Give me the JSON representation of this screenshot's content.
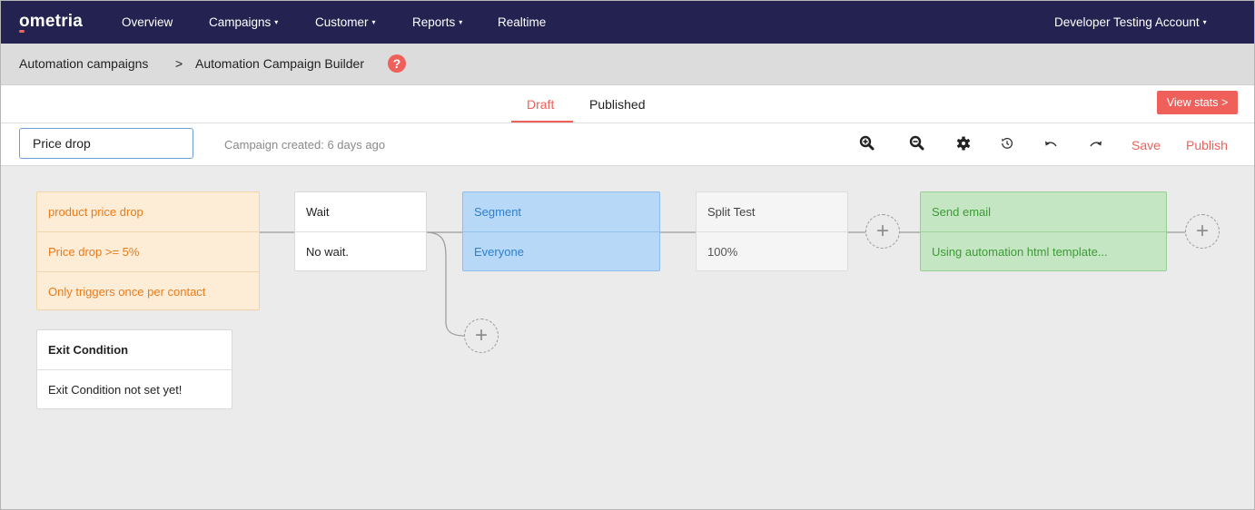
{
  "nav": {
    "logo": "ometria",
    "items": [
      {
        "label": "Overview",
        "caret": ""
      },
      {
        "label": "Campaigns",
        "caret": "▾"
      },
      {
        "label": "Customer",
        "caret": "▾"
      },
      {
        "label": "Reports",
        "caret": "▾"
      },
      {
        "label": "Realtime",
        "caret": ""
      }
    ],
    "account": {
      "label": "Developer Testing Account",
      "caret": "▾"
    }
  },
  "breadcrumb": {
    "parent": "Automation campaigns",
    "separator": ">",
    "current": "Automation Campaign Builder",
    "help_icon": "?"
  },
  "tabs": {
    "draft": "Draft",
    "published": "Published",
    "active": "Draft",
    "view_stats": "View stats >"
  },
  "toolbar": {
    "campaign_name": "Price drop",
    "created": "Campaign created: 6 days ago",
    "icons": [
      "zoom-in-icon",
      "zoom-out-icon",
      "gear-icon",
      "history-icon",
      "undo-icon",
      "redo-icon"
    ],
    "save": "Save",
    "publish": "Publish"
  },
  "canvas": {
    "trigger": {
      "title": "product price drop",
      "condition": "Price drop >= 5%",
      "frequency": "Only triggers once per contact"
    },
    "exit": {
      "title": "Exit Condition",
      "body": "Exit Condition not set yet!"
    },
    "wait": {
      "title": "Wait",
      "body": "No wait."
    },
    "segment": {
      "title": "Segment",
      "body": "Everyone"
    },
    "split": {
      "title": "Split Test",
      "body": "100%"
    },
    "email": {
      "title": "Send email",
      "body": "Using automation html template..."
    },
    "add_glyph": "+"
  },
  "colors": {
    "nav_bg": "#232250",
    "accent": "#f0605a",
    "trigger_bg": "#fdecd6",
    "trigger_text": "#ea7c1b",
    "segment_bg": "#b7d8f6",
    "segment_text": "#2d7fd0",
    "email_bg": "#c5e6c3",
    "email_text": "#3b9b34",
    "canvas_bg": "#ebebeb"
  }
}
